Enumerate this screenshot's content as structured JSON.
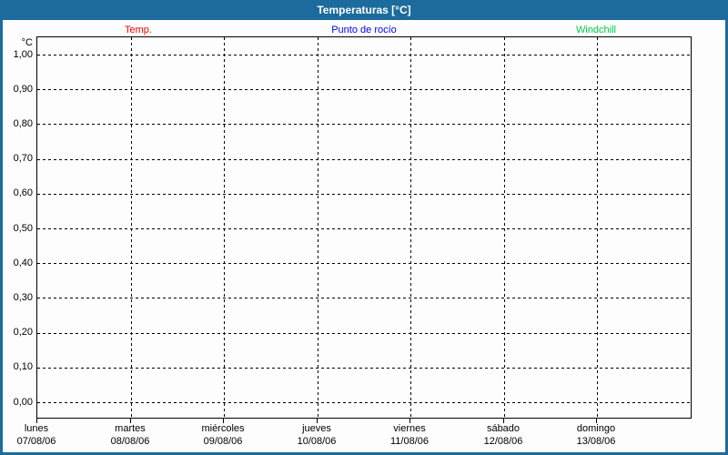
{
  "window": {
    "title": "Temperaturas [°C]"
  },
  "colors": {
    "frame": "#1c6b9d",
    "title_text": "#ffffff",
    "plot_background": "#fdfdfd",
    "grid": "#000000",
    "series_temp": "#ff0000",
    "series_dew_point": "#0000ff",
    "series_windchill": "#00cc44"
  },
  "chart_data": {
    "type": "line",
    "title": "Temperaturas [°C]",
    "ylabel": "°C",
    "ylim": [
      0.0,
      1.0
    ],
    "y_tick_step": 0.1,
    "y_tick_labels": [
      "1,00",
      "0,90",
      "0,80",
      "0,70",
      "0,60",
      "0,50",
      "0,40",
      "0,30",
      "0,20",
      "0,10",
      "0,00"
    ],
    "x_categories": [
      {
        "day": "lunes",
        "date": "07/08/06"
      },
      {
        "day": "martes",
        "date": "08/08/06"
      },
      {
        "day": "miércoles",
        "date": "09/08/06"
      },
      {
        "day": "jueves",
        "date": "10/08/06"
      },
      {
        "day": "viernes",
        "date": "11/08/06"
      },
      {
        "day": "sábado",
        "date": "12/08/06"
      },
      {
        "day": "domingo",
        "date": "13/08/06"
      }
    ],
    "grid": "dashed",
    "legend_position": "top",
    "series": [
      {
        "name": "Temp.",
        "color": "#ff0000",
        "values": []
      },
      {
        "name": "Punto de rocío",
        "color": "#0000ff",
        "values": []
      },
      {
        "name": "Windchill",
        "color": "#00cc44",
        "values": []
      }
    ]
  }
}
